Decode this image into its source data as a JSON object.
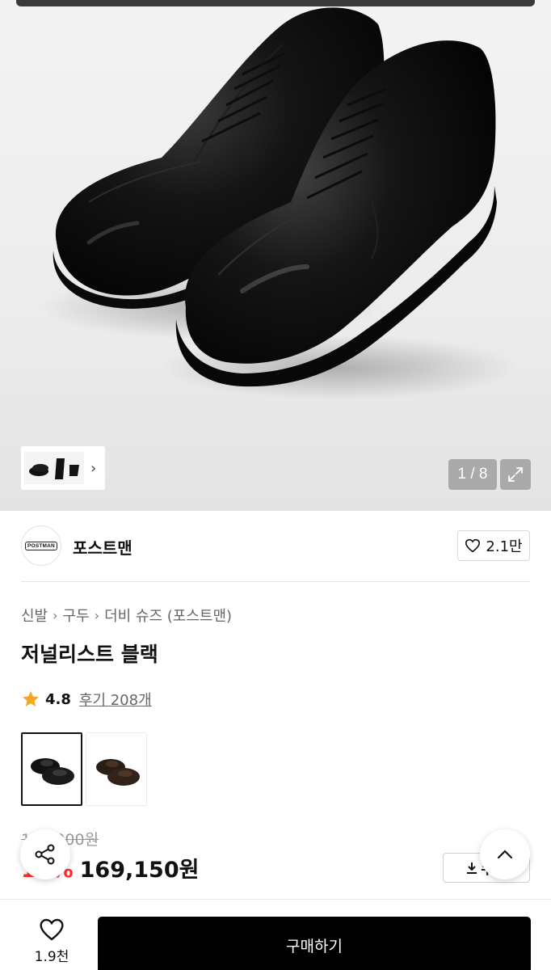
{
  "gallery": {
    "counter": "1 / 8",
    "icons": {
      "expand": "expand-icon",
      "next": "chevron-right-icon"
    }
  },
  "brand": {
    "logo_text": "POSTMAN",
    "name": "포스트맨",
    "likes": "2.1만"
  },
  "breadcrumb": [
    "신발",
    "구두",
    "더비 슈즈 (포스트맨)"
  ],
  "product": {
    "title": "저널리스트 블랙",
    "rating": "4.8",
    "review_label": "후기 208개"
  },
  "price": {
    "original": "199,000원",
    "discount": "15%",
    "sale": "169,150원",
    "coupon_label": "쿠폰"
  },
  "bottom": {
    "wish_count": "1.9천",
    "buy_label": "구매하기"
  },
  "colors": {
    "discount": "#ff2d2d",
    "star": "#f5a623",
    "buy_bg": "#000000"
  }
}
